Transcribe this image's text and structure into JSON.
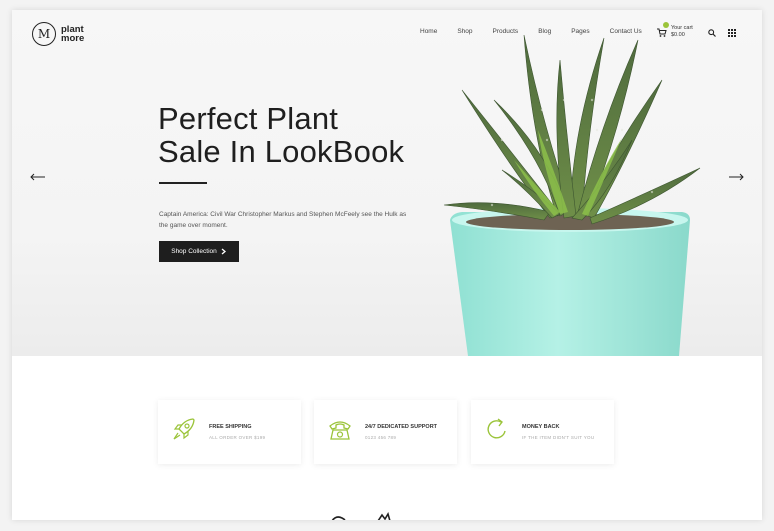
{
  "brand": {
    "logo_letter": "M",
    "name_line1": "plant",
    "name_line2": "more"
  },
  "nav": {
    "items": [
      "Home",
      "Shop",
      "Products",
      "Blog",
      "Pages",
      "Contact Us"
    ]
  },
  "cart": {
    "label": "Your cart",
    "amount": "$0.00",
    "accent": "#9bc43a"
  },
  "hero": {
    "title_line1": "Perfect Plant",
    "title_line2": "Sale In LookBook",
    "subtitle": "Captain America: Civil War Christopher Markus and Stephen McFeely see the Hulk as the game over moment.",
    "cta_label": "Shop Collection",
    "cta_icon": "chevron-right-icon",
    "prev_icon": "arrow-left-icon",
    "next_icon": "arrow-right-icon"
  },
  "features": [
    {
      "icon": "rocket-icon",
      "title": "FREE SHIPPING",
      "subtitle": "ALL ORDER OVER $199"
    },
    {
      "icon": "telephone-icon",
      "title": "24/7 DEDICATED SUPPORT",
      "subtitle": "0123 456 789"
    },
    {
      "icon": "refresh-icon",
      "title": "MONEY BACK",
      "subtitle": "IF THE ITEM DIDN'T SUIT YOU"
    }
  ],
  "colors": {
    "accent": "#9bc43a",
    "dark": "#1e1e1e",
    "pot": "#a8ecdf"
  }
}
